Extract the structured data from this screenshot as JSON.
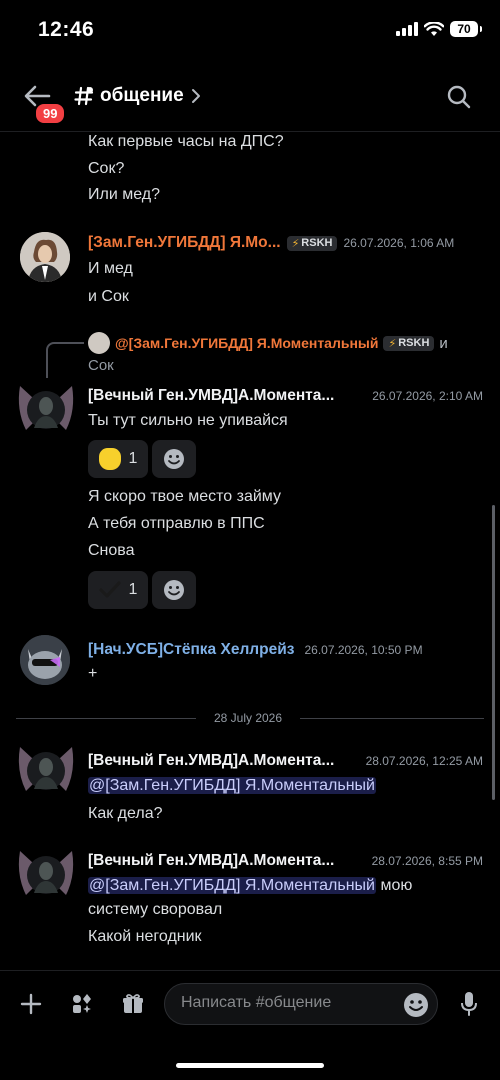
{
  "status_bar": {
    "time": "12:46",
    "battery": "70"
  },
  "header": {
    "unread_badge": "99",
    "channel_name": "общение"
  },
  "messages_top": [
    "Как первые часы на ДПС?",
    "Сок?",
    "Или мед?"
  ],
  "msg1": {
    "author": "[Зам.Ген.УГИБДД] Я.Мо...",
    "tag": "RSKH",
    "timestamp": "26.07.2026, 1:06 AM",
    "lines": [
      "И мед",
      "и Сок"
    ],
    "author_color": "#f0773a"
  },
  "reply": {
    "author": "@[Зам.Ген.УГИБДД] Я.Моментальный",
    "tag": "RSKH",
    "suffix": "и",
    "text": "Сок"
  },
  "msg2": {
    "author": "[Вечный Ген.УМВД]А.Моментa...",
    "timestamp": "26.07.2026, 2:10 AM",
    "line1": "Ты тут сильно не упивайся",
    "reaction1_count": "1",
    "lines": [
      "Я скоро твое место займу",
      "А тебя отправлю в ППС",
      "Снова"
    ],
    "reaction2_count": "1"
  },
  "msg3": {
    "author": "[Нач.УСБ]Стёпка Хеллрейз",
    "timestamp": "26.07.2026, 10:50 PM",
    "text": "+",
    "author_color": "#7fb0e6"
  },
  "date_divider": "28 July 2026",
  "msg4": {
    "author": "[Вечный Ген.УМВД]А.Моментa...",
    "timestamp": "28.07.2026, 12:25 AM",
    "mention": "@[Зам.Ген.УГИБДД] Я.Моментальный",
    "line": "Как дела?"
  },
  "msg5": {
    "author": "[Вечный Ген.УМВД]А.Моментa...",
    "timestamp": "28.07.2026, 8:55 PM",
    "mention": "@[Зам.Ген.УГИБДД] Я.Моментальный",
    "mention_suffix": " мою",
    "line2": "систему своровал",
    "line3": "Какой негодник"
  },
  "composer": {
    "placeholder": "Написать #общение"
  },
  "colors": {
    "background": "#000000",
    "mention_bg": "#3c4270",
    "reaction_bg": "#1e1f22",
    "badge_red": "#f23f43"
  }
}
